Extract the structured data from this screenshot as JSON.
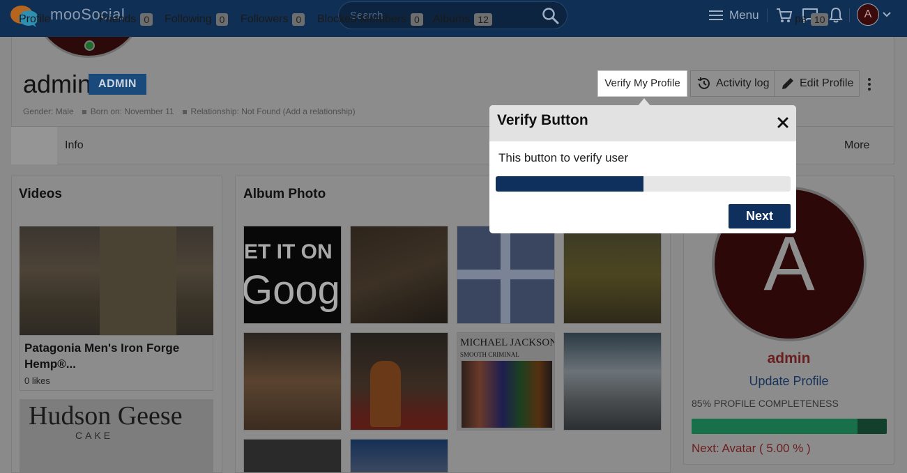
{
  "header": {
    "brand": "mooSocial",
    "search_placeholder": "Search",
    "menu_label": "Menu",
    "avatar_letter": "A"
  },
  "profile": {
    "username": "admin",
    "role_badge": "ADMIN",
    "gender": "Gender: Male",
    "born": "Born on: November 11",
    "relationship": "Relationship: Not Found (Add a relationship)",
    "actions": {
      "verify": "Verify My Profile",
      "activity": "Activity log",
      "edit": "Edit Profile"
    }
  },
  "tabs": [
    {
      "label": "Profile"
    },
    {
      "label": "Info"
    },
    {
      "label": "Friends",
      "count": "0"
    },
    {
      "label": "Following",
      "count": "0"
    },
    {
      "label": "Followers",
      "count": "0"
    },
    {
      "label": "Blocked Members",
      "count": "0"
    },
    {
      "label": "Albums",
      "count": "12"
    },
    {
      "label": "ps",
      "count": "10"
    },
    {
      "label": "More"
    }
  ],
  "videos": {
    "title": "Videos",
    "items": [
      {
        "title": "Patagonia Men's Iron Forge Hemp®...",
        "likes": "0 likes"
      },
      {
        "thumb_title": "Hudson Geese",
        "thumb_sub": "CAKE"
      }
    ]
  },
  "album": {
    "title": "Album Photo",
    "photo1_text": "ET IT ON",
    "photo1_text2": "Googl",
    "photo7_text": "MICHAEL JACKSON",
    "photo7_sub": "SMOOTH CRIMINAL"
  },
  "sidebar": {
    "avatar_letter": "A",
    "name": "admin",
    "update": "Update Profile",
    "completeness": "85% PROFILE COMPLETENESS",
    "completeness_fraction": 0.85,
    "next": "Next: Avatar ( 5.00 % )"
  },
  "popup": {
    "title": "Verify Button",
    "text": "This button to verify user",
    "progress_fraction": 0.5,
    "next_label": "Next"
  }
}
